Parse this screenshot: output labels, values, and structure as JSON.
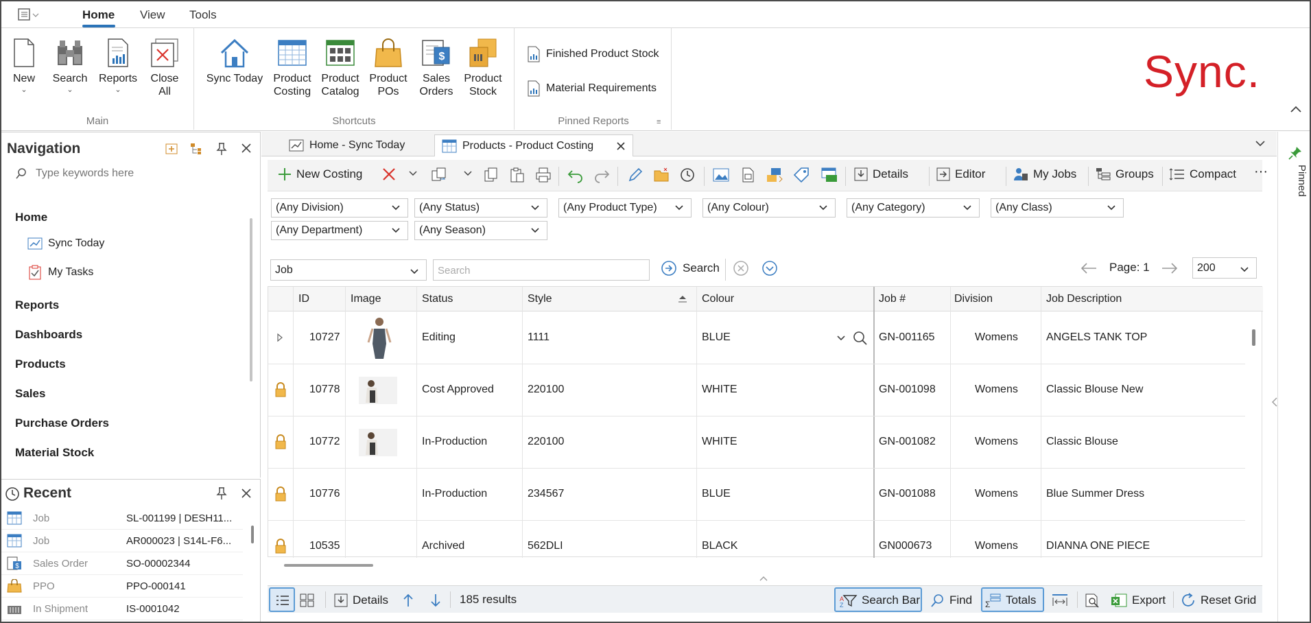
{
  "ribbon_tabs": [
    {
      "label": "Home"
    },
    {
      "label": "View"
    },
    {
      "label": "Tools"
    }
  ],
  "ribbon": {
    "main": {
      "label": "Main",
      "new": "New",
      "search": "Search",
      "reports": "Reports",
      "close_all_1": "Close",
      "close_all_2": "All"
    },
    "shortcuts": {
      "label": "Shortcuts",
      "sync_today": "Sync Today",
      "product_costing_1": "Product",
      "product_costing_2": "Costing",
      "product_catalog_1": "Product",
      "product_catalog_2": "Catalog",
      "product_pos_1": "Product",
      "product_pos_2": "POs",
      "sales_orders_1": "Sales",
      "sales_orders_2": "Orders",
      "product_stock_1": "Product",
      "product_stock_2": "Stock"
    },
    "pinned_reports": {
      "label": "Pinned Reports",
      "items": [
        {
          "label": "Finished Product Stock"
        },
        {
          "label": "Material Requirements"
        }
      ]
    },
    "logo_text": "Sync."
  },
  "navigation": {
    "title": "Navigation",
    "search_placeholder": "Type keywords here",
    "home": "Home",
    "sub_items": [
      {
        "label": "Sync Today"
      },
      {
        "label": "My Tasks"
      }
    ],
    "sections": [
      {
        "label": "Reports"
      },
      {
        "label": "Dashboards"
      },
      {
        "label": "Products"
      },
      {
        "label": "Sales"
      },
      {
        "label": "Purchase Orders"
      },
      {
        "label": "Material Stock"
      }
    ]
  },
  "recent": {
    "title": "Recent",
    "items": [
      {
        "type": "Job",
        "value": "SL-001199 | DESH11..."
      },
      {
        "type": "Job",
        "value": "AR000023 | S14L-F6..."
      },
      {
        "type": "Sales Order",
        "value": "SO-00002344"
      },
      {
        "type": "PPO",
        "value": "PPO-000141"
      },
      {
        "type": "In Shipment",
        "value": "IS-0001042"
      }
    ]
  },
  "doc_tabs": [
    {
      "label": "Home - Sync Today"
    },
    {
      "label": "Products - Product Costing"
    }
  ],
  "toolbar": {
    "new_costing": "New Costing",
    "details": "Details",
    "editor": "Editor",
    "my_jobs": "My Jobs",
    "groups": "Groups",
    "compact": "Compact",
    "more": "···"
  },
  "filters": [
    {
      "value": "(Any Division)"
    },
    {
      "value": "(Any Status)"
    },
    {
      "value": "(Any Product Type)"
    },
    {
      "value": "(Any Colour)"
    },
    {
      "value": "(Any Category)"
    },
    {
      "value": "(Any Class)"
    },
    {
      "value": "(Any Department)"
    },
    {
      "value": "(Any Season)"
    }
  ],
  "search": {
    "field": "Job",
    "placeholder": "Search",
    "button": "Search",
    "page_label": "Page: 1",
    "page_size": "200"
  },
  "grid": {
    "columns": [
      {
        "label": "ID"
      },
      {
        "label": "Image"
      },
      {
        "label": "Status"
      },
      {
        "label": "Style"
      },
      {
        "label": "Colour"
      },
      {
        "label": "Job #"
      },
      {
        "label": "Division"
      },
      {
        "label": "Job Description"
      }
    ],
    "rows": [
      {
        "id": "10727",
        "status": "Editing",
        "style": "1111",
        "colour": "BLUE",
        "job": "GN-001165",
        "division": "Womens",
        "desc": "ANGELS TANK TOP"
      },
      {
        "id": "10778",
        "status": "Cost Approved",
        "style": "220100",
        "colour": "WHITE",
        "job": "GN-001098",
        "division": "Womens",
        "desc": "Classic Blouse New"
      },
      {
        "id": "10772",
        "status": "In-Production",
        "style": "220100",
        "colour": "WHITE",
        "job": "GN-001082",
        "division": "Womens",
        "desc": "Classic Blouse"
      },
      {
        "id": "10776",
        "status": "In-Production",
        "style": "234567",
        "colour": "BLUE",
        "job": "GN-001088",
        "division": "Womens",
        "desc": "Blue Summer Dress"
      },
      {
        "id": "10535",
        "status": "Archived",
        "style": "562DLI",
        "colour": "BLACK",
        "job": "GN000673",
        "division": "Womens",
        "desc": "DIANNA ONE PIECE"
      }
    ]
  },
  "statusbar": {
    "details": "Details",
    "results": "185 results",
    "search_bar": "Search Bar",
    "find": "Find",
    "totals": "Totals",
    "export": "Export",
    "reset_grid": "Reset Grid"
  },
  "pinned_side": "Pinned",
  "colors": {
    "accent": "#2b73b8",
    "logo_red": "#d42027",
    "toolbar_green": "#3a9b3a",
    "delete_red": "#d9332b"
  }
}
